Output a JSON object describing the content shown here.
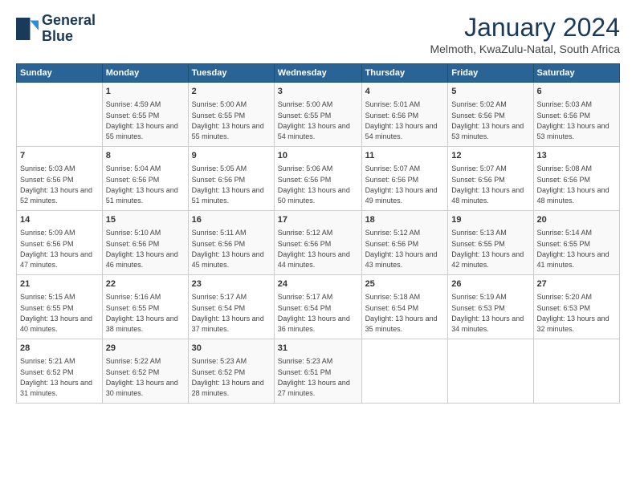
{
  "logo": {
    "line1": "General",
    "line2": "Blue"
  },
  "title": "January 2024",
  "location": "Melmoth, KwaZulu-Natal, South Africa",
  "headers": [
    "Sunday",
    "Monday",
    "Tuesday",
    "Wednesday",
    "Thursday",
    "Friday",
    "Saturday"
  ],
  "weeks": [
    [
      {
        "day": "",
        "sunrise": "",
        "sunset": "",
        "daylight": ""
      },
      {
        "day": "1",
        "sunrise": "Sunrise: 4:59 AM",
        "sunset": "Sunset: 6:55 PM",
        "daylight": "Daylight: 13 hours and 55 minutes."
      },
      {
        "day": "2",
        "sunrise": "Sunrise: 5:00 AM",
        "sunset": "Sunset: 6:55 PM",
        "daylight": "Daylight: 13 hours and 55 minutes."
      },
      {
        "day": "3",
        "sunrise": "Sunrise: 5:00 AM",
        "sunset": "Sunset: 6:55 PM",
        "daylight": "Daylight: 13 hours and 54 minutes."
      },
      {
        "day": "4",
        "sunrise": "Sunrise: 5:01 AM",
        "sunset": "Sunset: 6:56 PM",
        "daylight": "Daylight: 13 hours and 54 minutes."
      },
      {
        "day": "5",
        "sunrise": "Sunrise: 5:02 AM",
        "sunset": "Sunset: 6:56 PM",
        "daylight": "Daylight: 13 hours and 53 minutes."
      },
      {
        "day": "6",
        "sunrise": "Sunrise: 5:03 AM",
        "sunset": "Sunset: 6:56 PM",
        "daylight": "Daylight: 13 hours and 53 minutes."
      }
    ],
    [
      {
        "day": "7",
        "sunrise": "Sunrise: 5:03 AM",
        "sunset": "Sunset: 6:56 PM",
        "daylight": "Daylight: 13 hours and 52 minutes."
      },
      {
        "day": "8",
        "sunrise": "Sunrise: 5:04 AM",
        "sunset": "Sunset: 6:56 PM",
        "daylight": "Daylight: 13 hours and 51 minutes."
      },
      {
        "day": "9",
        "sunrise": "Sunrise: 5:05 AM",
        "sunset": "Sunset: 6:56 PM",
        "daylight": "Daylight: 13 hours and 51 minutes."
      },
      {
        "day": "10",
        "sunrise": "Sunrise: 5:06 AM",
        "sunset": "Sunset: 6:56 PM",
        "daylight": "Daylight: 13 hours and 50 minutes."
      },
      {
        "day": "11",
        "sunrise": "Sunrise: 5:07 AM",
        "sunset": "Sunset: 6:56 PM",
        "daylight": "Daylight: 13 hours and 49 minutes."
      },
      {
        "day": "12",
        "sunrise": "Sunrise: 5:07 AM",
        "sunset": "Sunset: 6:56 PM",
        "daylight": "Daylight: 13 hours and 48 minutes."
      },
      {
        "day": "13",
        "sunrise": "Sunrise: 5:08 AM",
        "sunset": "Sunset: 6:56 PM",
        "daylight": "Daylight: 13 hours and 48 minutes."
      }
    ],
    [
      {
        "day": "14",
        "sunrise": "Sunrise: 5:09 AM",
        "sunset": "Sunset: 6:56 PM",
        "daylight": "Daylight: 13 hours and 47 minutes."
      },
      {
        "day": "15",
        "sunrise": "Sunrise: 5:10 AM",
        "sunset": "Sunset: 6:56 PM",
        "daylight": "Daylight: 13 hours and 46 minutes."
      },
      {
        "day": "16",
        "sunrise": "Sunrise: 5:11 AM",
        "sunset": "Sunset: 6:56 PM",
        "daylight": "Daylight: 13 hours and 45 minutes."
      },
      {
        "day": "17",
        "sunrise": "Sunrise: 5:12 AM",
        "sunset": "Sunset: 6:56 PM",
        "daylight": "Daylight: 13 hours and 44 minutes."
      },
      {
        "day": "18",
        "sunrise": "Sunrise: 5:12 AM",
        "sunset": "Sunset: 6:56 PM",
        "daylight": "Daylight: 13 hours and 43 minutes."
      },
      {
        "day": "19",
        "sunrise": "Sunrise: 5:13 AM",
        "sunset": "Sunset: 6:55 PM",
        "daylight": "Daylight: 13 hours and 42 minutes."
      },
      {
        "day": "20",
        "sunrise": "Sunrise: 5:14 AM",
        "sunset": "Sunset: 6:55 PM",
        "daylight": "Daylight: 13 hours and 41 minutes."
      }
    ],
    [
      {
        "day": "21",
        "sunrise": "Sunrise: 5:15 AM",
        "sunset": "Sunset: 6:55 PM",
        "daylight": "Daylight: 13 hours and 40 minutes."
      },
      {
        "day": "22",
        "sunrise": "Sunrise: 5:16 AM",
        "sunset": "Sunset: 6:55 PM",
        "daylight": "Daylight: 13 hours and 38 minutes."
      },
      {
        "day": "23",
        "sunrise": "Sunrise: 5:17 AM",
        "sunset": "Sunset: 6:54 PM",
        "daylight": "Daylight: 13 hours and 37 minutes."
      },
      {
        "day": "24",
        "sunrise": "Sunrise: 5:17 AM",
        "sunset": "Sunset: 6:54 PM",
        "daylight": "Daylight: 13 hours and 36 minutes."
      },
      {
        "day": "25",
        "sunrise": "Sunrise: 5:18 AM",
        "sunset": "Sunset: 6:54 PM",
        "daylight": "Daylight: 13 hours and 35 minutes."
      },
      {
        "day": "26",
        "sunrise": "Sunrise: 5:19 AM",
        "sunset": "Sunset: 6:53 PM",
        "daylight": "Daylight: 13 hours and 34 minutes."
      },
      {
        "day": "27",
        "sunrise": "Sunrise: 5:20 AM",
        "sunset": "Sunset: 6:53 PM",
        "daylight": "Daylight: 13 hours and 32 minutes."
      }
    ],
    [
      {
        "day": "28",
        "sunrise": "Sunrise: 5:21 AM",
        "sunset": "Sunset: 6:52 PM",
        "daylight": "Daylight: 13 hours and 31 minutes."
      },
      {
        "day": "29",
        "sunrise": "Sunrise: 5:22 AM",
        "sunset": "Sunset: 6:52 PM",
        "daylight": "Daylight: 13 hours and 30 minutes."
      },
      {
        "day": "30",
        "sunrise": "Sunrise: 5:23 AM",
        "sunset": "Sunset: 6:52 PM",
        "daylight": "Daylight: 13 hours and 28 minutes."
      },
      {
        "day": "31",
        "sunrise": "Sunrise: 5:23 AM",
        "sunset": "Sunset: 6:51 PM",
        "daylight": "Daylight: 13 hours and 27 minutes."
      },
      {
        "day": "",
        "sunrise": "",
        "sunset": "",
        "daylight": ""
      },
      {
        "day": "",
        "sunrise": "",
        "sunset": "",
        "daylight": ""
      },
      {
        "day": "",
        "sunrise": "",
        "sunset": "",
        "daylight": ""
      }
    ]
  ]
}
